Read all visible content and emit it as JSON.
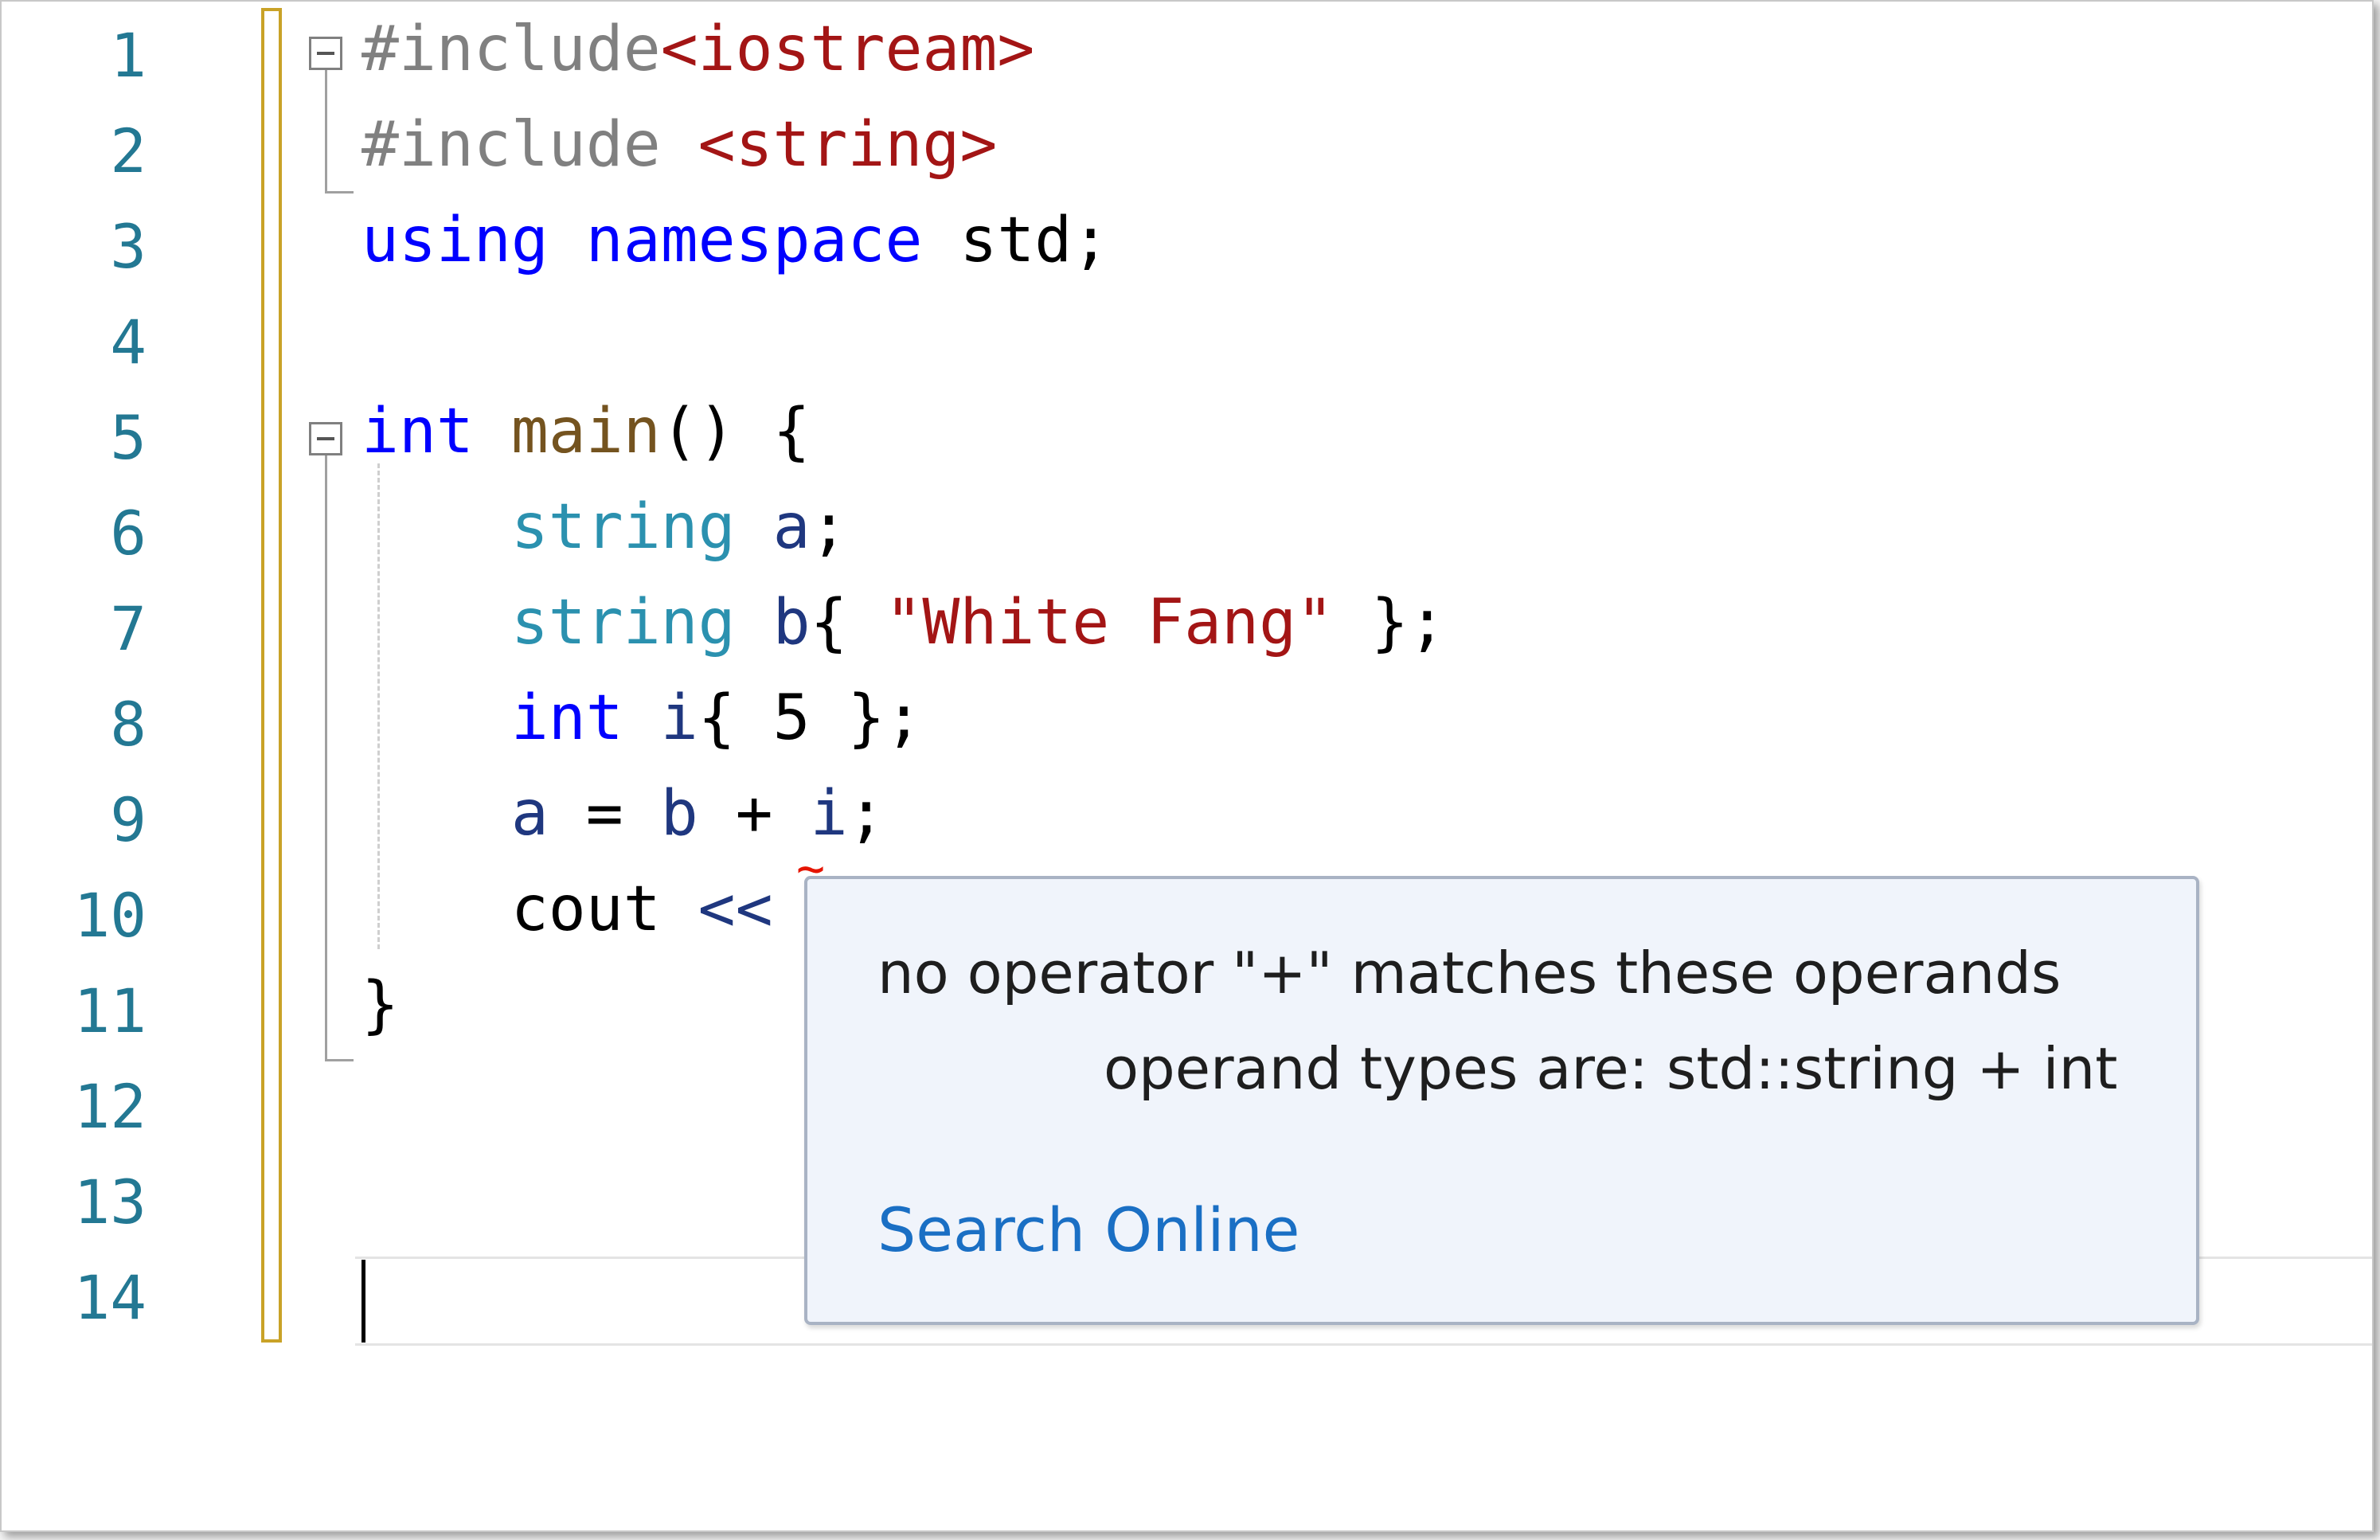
{
  "editor": {
    "line_numbers": [
      "1",
      "2",
      "3",
      "4",
      "5",
      "6",
      "7",
      "8",
      "9",
      "10",
      "11",
      "12",
      "13",
      "14"
    ],
    "lines": {
      "l1": {
        "a": "#include",
        "b": "<iostream>"
      },
      "l2": {
        "a": "#include ",
        "b": "<string>"
      },
      "l3": {
        "kw1": "using",
        "kw2": "namespace",
        "c": "std;"
      },
      "l5": {
        "kw": "int",
        "fn": "main",
        "rest": "() {"
      },
      "l6": {
        "ty": "string",
        "var": "a",
        "rest": ";"
      },
      "l7": {
        "ty": "string",
        "var": "b",
        "p1": "{ ",
        "str": "\"White Fang\"",
        "p2": " };"
      },
      "l8": {
        "kw": "int",
        "var": "i",
        "p1": "{ 5 };"
      },
      "l9": {
        "v1": "a",
        "op1": " = ",
        "v2": "b",
        "op2": " + ",
        "v3": "i",
        "rest": ";"
      },
      "l10": {
        "id": "cout",
        "op": "<<"
      },
      "l11": {
        "brace": "}"
      }
    },
    "squiggle": "~"
  },
  "tooltip": {
    "message": "no operator \"+\" matches these operands",
    "detail": "operand types are: std::string + int",
    "link": "Search Online"
  }
}
